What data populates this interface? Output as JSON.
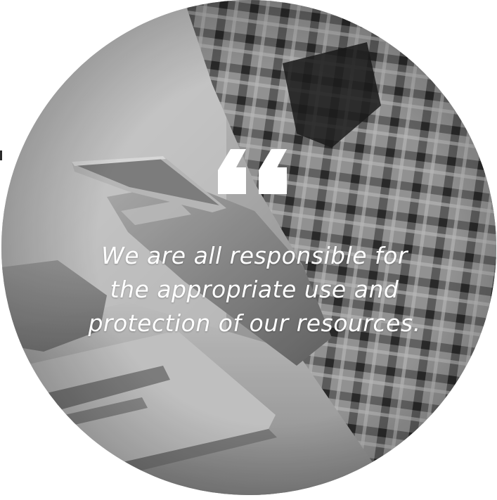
{
  "quote": {
    "icon": "quotation-mark-icon",
    "lines": [
      "We are all responsible for",
      "the appropriate use and",
      "protection of our resources."
    ]
  },
  "colors": {
    "text": "#ffffff",
    "quote_mark": "#ffffff",
    "background": "#ffffff",
    "photo_tone": "grayscale"
  }
}
